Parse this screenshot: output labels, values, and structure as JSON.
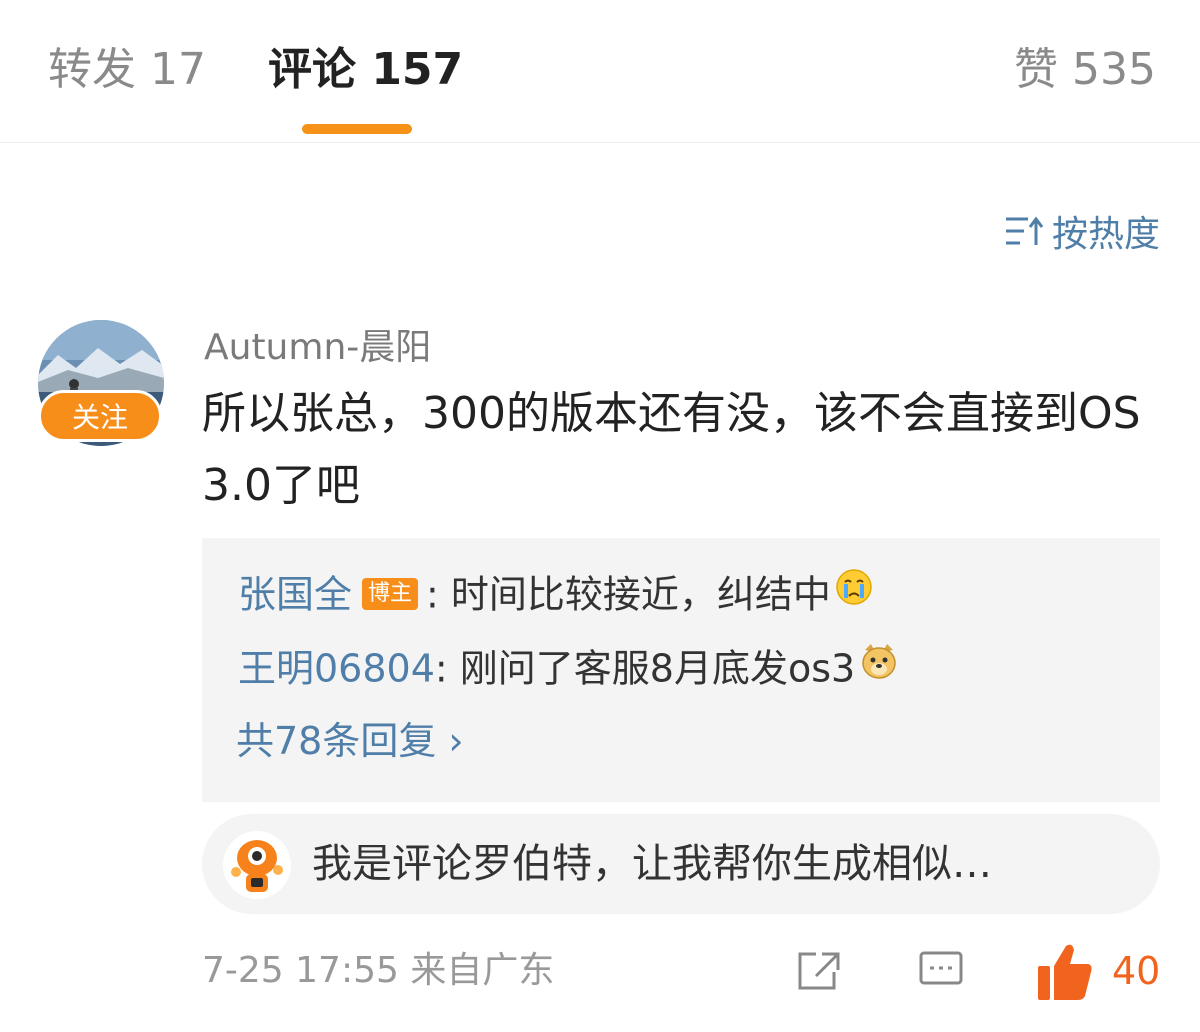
{
  "tabs": {
    "repost": "转发 17",
    "comments": "评论 157",
    "likes": "赞 535"
  },
  "sort": {
    "label": "按热度"
  },
  "comment": {
    "username": "Autumn-晨阳",
    "follow_label": "关注",
    "text": "所以张总，300的版本还有没，该不会直接到OS 3.0了吧",
    "replies": [
      {
        "author": "张国全",
        "badge": "博主",
        "text": ": 时间比较接近，纠结中",
        "emoji": "crying-face"
      },
      {
        "author": "王明06804",
        "text": ": 刚问了客服8月底发os3",
        "emoji": "doge-face"
      }
    ],
    "more_replies": "共78条回复 ›",
    "robot_suggestion": "我是评论罗伯特，让我帮你生成相似…",
    "meta": "7-25 17:55  来自广东",
    "like_count": "40"
  },
  "colors": {
    "accent": "#f79219",
    "link_blue": "#4f7ea8",
    "like_orange": "#f0641e"
  }
}
